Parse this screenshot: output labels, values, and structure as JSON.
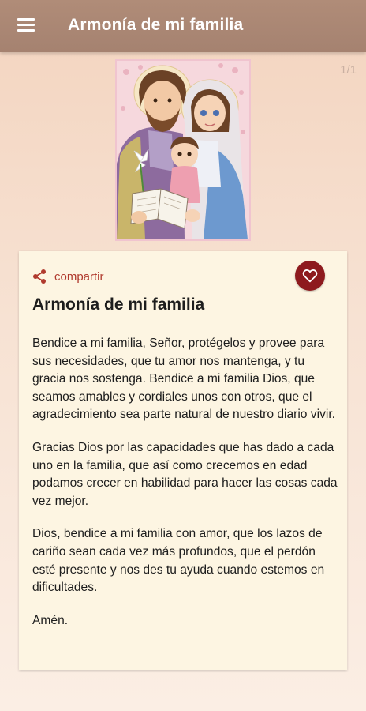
{
  "app_bar": {
    "title": "Armonía de mi familia"
  },
  "page_indicator": "1/1",
  "card": {
    "share_label": "compartir",
    "title": "Armonía de mi familia",
    "paragraphs": [
      "Bendice a mi familia, Señor, protégelos y provee para sus necesidades, que tu amor nos mantenga, y tu gracia nos sostenga. Bendice a mi familia Dios, que seamos amables y cordiales unos con otros, que el agradecimiento sea parte natural de nuestro diario vivir.",
      "Gracias Dios por las capacidades que has dado a cada uno en la familia, que así como crecemos en edad podamos crecer en habilidad para hacer las cosas cada vez mejor.",
      "Dios, bendice a mi familia con amor, que los lazos de cariño sean cada vez más profundos, que el perdón esté presente y nos des tu ayuda cuando estemos en dificultades.",
      "Amén."
    ]
  },
  "colors": {
    "app_bar": "#a58270",
    "accent": "#b03a2e",
    "favorite_button": "#8e1a1e",
    "card_background": "#fdf5e2"
  },
  "icons": {
    "menu": "menu-icon",
    "share": "share-icon",
    "favorite": "heart-outline-icon"
  }
}
